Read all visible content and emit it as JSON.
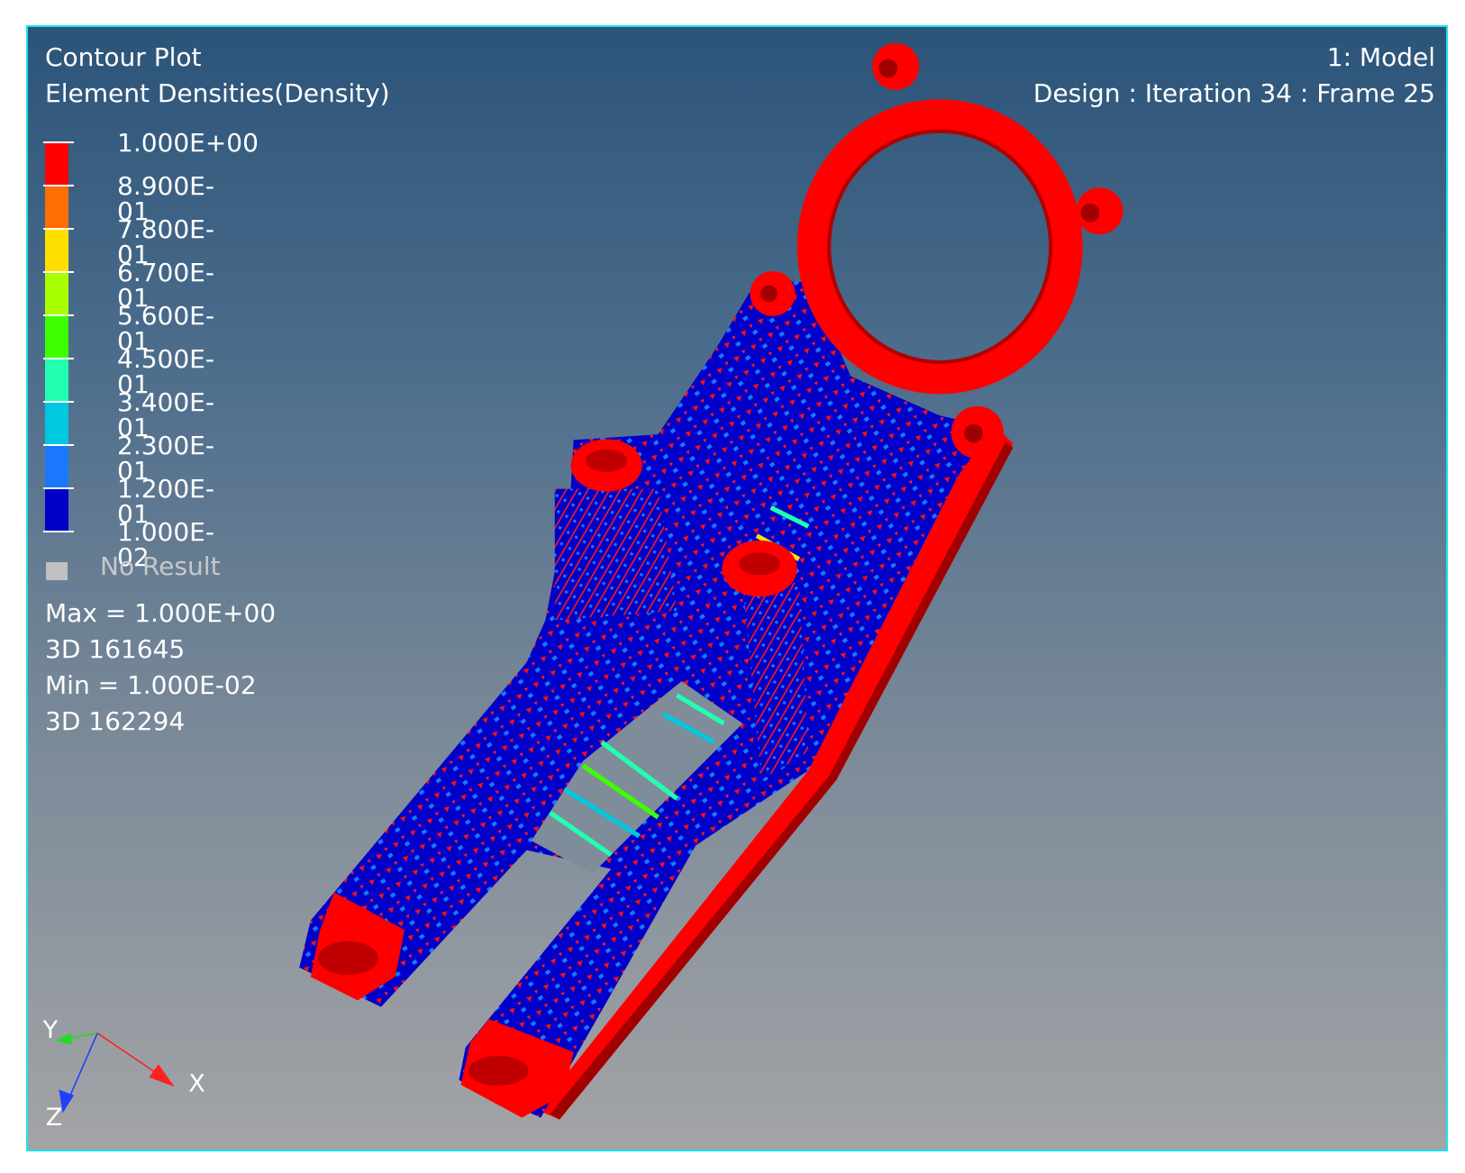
{
  "legend": {
    "title": "Contour Plot",
    "subtitle": "Element Densities(Density)",
    "levels": [
      "1.000E+00",
      "8.900E-01",
      "7.800E-01",
      "6.700E-01",
      "5.600E-01",
      "4.500E-01",
      "3.400E-01",
      "2.300E-01",
      "1.200E-01",
      "1.000E-02"
    ],
    "band_colors": [
      "#ff0000",
      "#ff6e00",
      "#ffdf00",
      "#a8ff00",
      "#3cff00",
      "#22ffb0",
      "#00c8de",
      "#1a78ff",
      "#0000c8"
    ],
    "no_result": "No Result",
    "no_result_color": "#c0c0c0",
    "max_line": "Max =  1.000E+00",
    "max_entity": "3D 161645",
    "min_line": "Min =  1.000E-02",
    "min_entity": "3D 162294"
  },
  "header": {
    "model": "1: Model",
    "design": "Design : Iteration 34 : Frame 25"
  },
  "triad": {
    "x": "X",
    "y": "Y",
    "z": "Z"
  },
  "colors": {
    "border": "#19e3ea",
    "solid": "#ff0000",
    "void": "#0000c8"
  }
}
